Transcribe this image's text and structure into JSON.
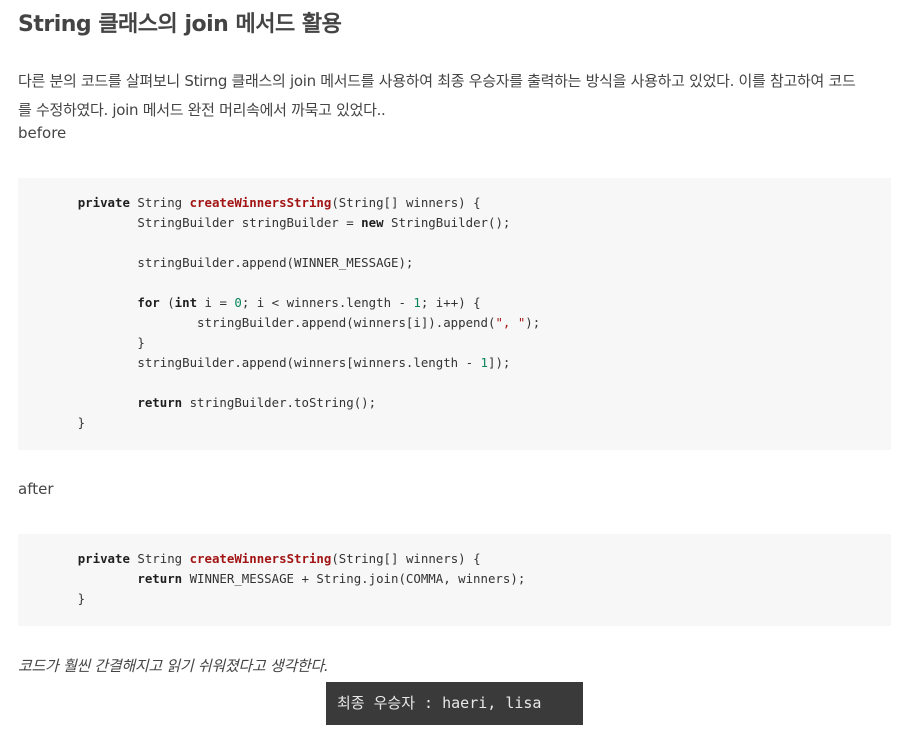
{
  "post": {
    "title": "String 클래스의 join 메서드 활용",
    "paragraph_lines": [
      "다른 분의 코드를 살펴보니 Stirng 클래스의 join 메서드를 사용하여 최종 우승자를 출력하는 방식을 사용하고 있었다. 이를 참고하여 코드",
      "를 수정하였다. join 메서드 완전 머리속에서 까묵고 있었다.."
    ],
    "before_label": "before",
    "after_label": "after",
    "closing": "코드가 훨씬 간결해지고 읽기 쉬워졌다고 생각한다."
  },
  "code_before": [
    [
      {
        "t": "        "
      },
      {
        "t": "private",
        "c": "kw"
      },
      {
        "t": " String "
      },
      {
        "t": "createWinnersString",
        "c": "fn"
      },
      {
        "t": "(String[] winners) {"
      }
    ],
    [
      {
        "t": "                StringBuilder stringBuilder = "
      },
      {
        "t": "new",
        "c": "kw"
      },
      {
        "t": " StringBuilder();"
      }
    ],
    [],
    [
      {
        "t": "                stringBuilder.append(WINNER_MESSAGE);"
      }
    ],
    [],
    [
      {
        "t": "                "
      },
      {
        "t": "for",
        "c": "kw"
      },
      {
        "t": " ("
      },
      {
        "t": "int",
        "c": "kw"
      },
      {
        "t": " i = "
      },
      {
        "t": "0",
        "c": "num"
      },
      {
        "t": "; i < winners.length - "
      },
      {
        "t": "1",
        "c": "num"
      },
      {
        "t": "; i++) {"
      }
    ],
    [
      {
        "t": "                        stringBuilder.append(winners[i]).append("
      },
      {
        "t": "\", \"",
        "c": "str"
      },
      {
        "t": ");"
      }
    ],
    [
      {
        "t": "                }"
      }
    ],
    [
      {
        "t": "                stringBuilder.append(winners[winners.length - "
      },
      {
        "t": "1",
        "c": "num"
      },
      {
        "t": "]);"
      }
    ],
    [],
    [
      {
        "t": "                "
      },
      {
        "t": "return",
        "c": "kw"
      },
      {
        "t": " stringBuilder.toString();"
      }
    ],
    [
      {
        "t": "        }"
      }
    ]
  ],
  "code_after": [
    [
      {
        "t": "        "
      },
      {
        "t": "private",
        "c": "kw"
      },
      {
        "t": " String "
      },
      {
        "t": "createWinnersString",
        "c": "fn"
      },
      {
        "t": "(String[] winners) {"
      }
    ],
    [
      {
        "t": "                "
      },
      {
        "t": "return",
        "c": "kw"
      },
      {
        "t": " WINNER_MESSAGE + String.join(COMMA, winners);"
      }
    ],
    [
      {
        "t": "        }"
      }
    ]
  ],
  "console_output": "최종 우승자 : haeri, lisa",
  "colors": {
    "code_background": "#f7f7f7",
    "keyword": "#1f1f1f",
    "method_name": "#a31515",
    "number": "#098658",
    "string": "#a31515",
    "console_background": "#3a3a3a",
    "console_text": "#e8e8e8"
  }
}
